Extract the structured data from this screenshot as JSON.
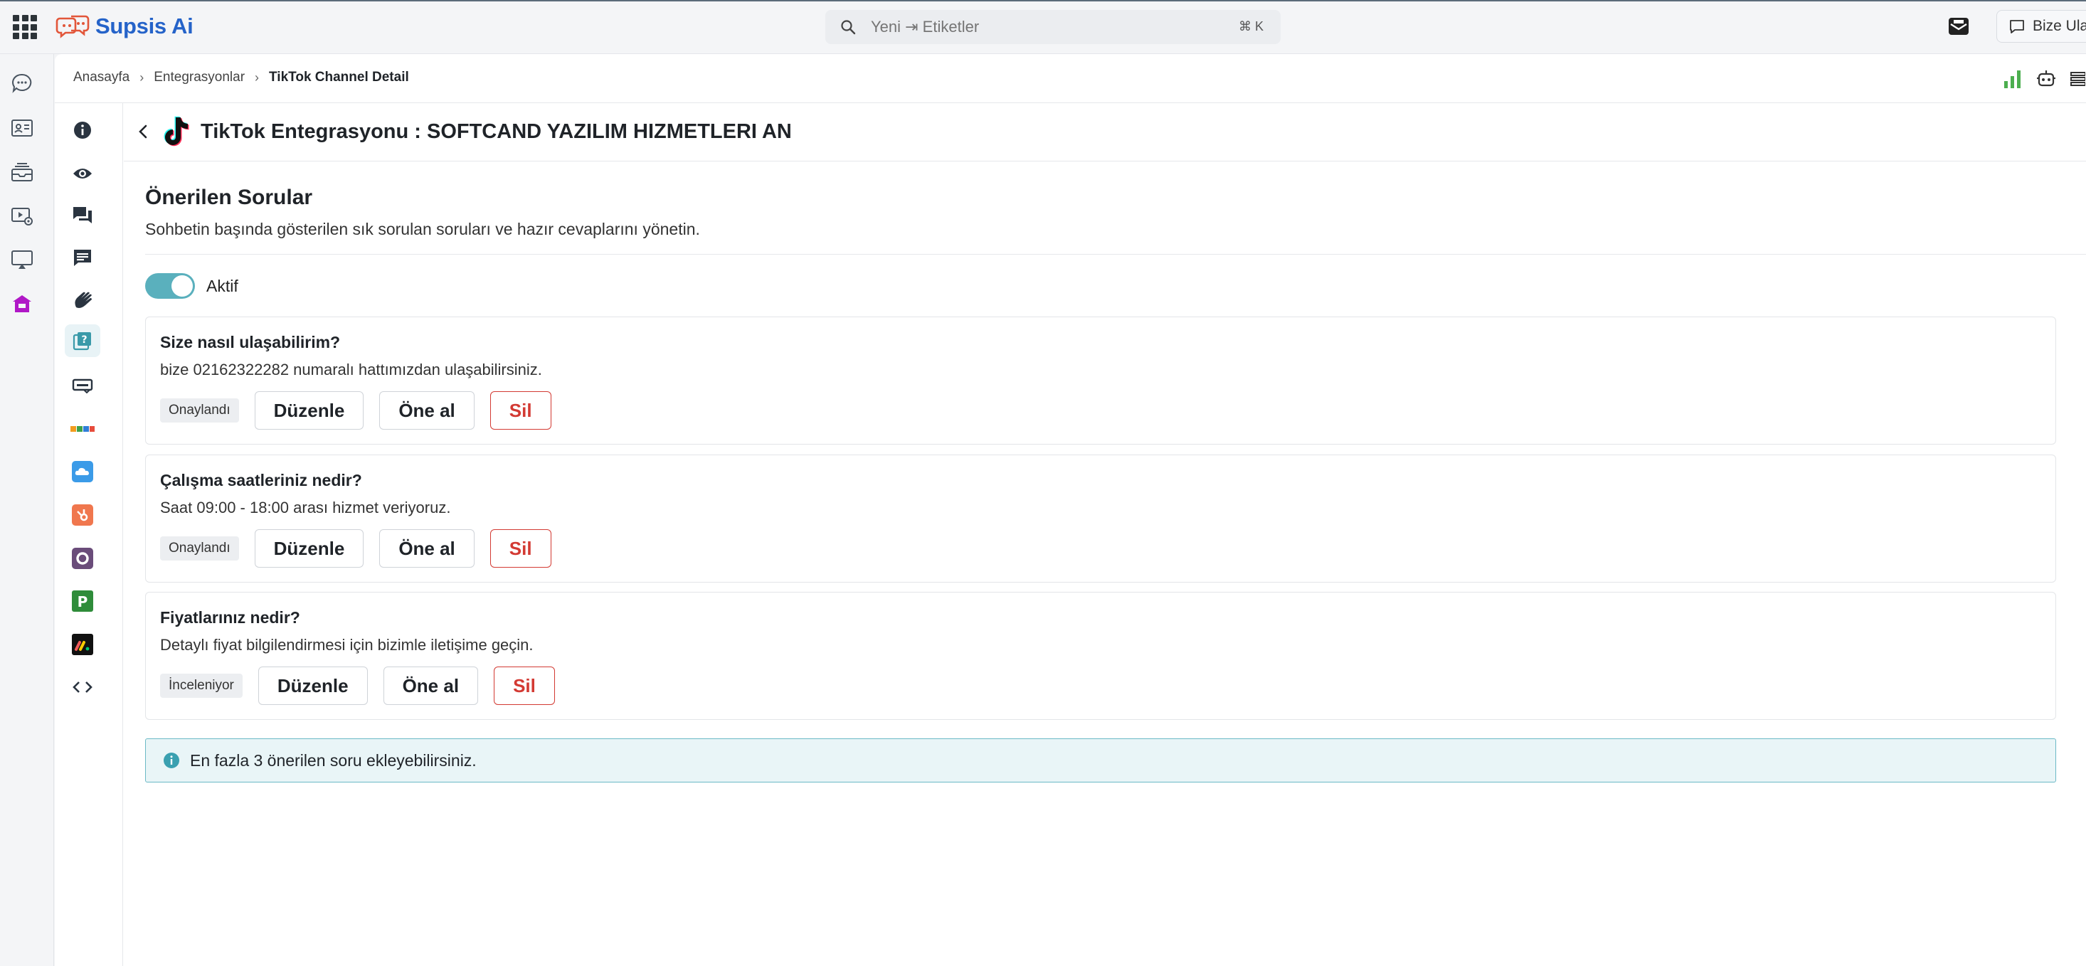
{
  "app": {
    "name": "Supsis Ai"
  },
  "search": {
    "placeholder": "Yeni ⇥ Etiketler",
    "shortcut": "⌘ K"
  },
  "top_right": {
    "contact_label": "Bize Ula"
  },
  "rail_icons": [
    "chat-bubble-icon",
    "contact-card-icon",
    "inbox-icon",
    "video-settings-icon",
    "screen-cast-icon",
    "store-icon"
  ],
  "breadcrumb": {
    "items": [
      "Anasayfa",
      "Entegrasyonlar"
    ],
    "current": "TikTok Channel Detail"
  },
  "subnav_icons": [
    "info-icon",
    "eye-icon",
    "forum-icon",
    "comment-icon",
    "waving-hand-icon",
    "quiz-icon",
    "keyboard-icon",
    "rainbow-app-icon",
    "cloud-icon",
    "hubspot-icon",
    "circle-app-icon",
    "p-app-icon",
    "monday-app-icon",
    "code-icon"
  ],
  "header": {
    "title": "TikTok Entegrasyonu : SOFTCAND YAZILIM HIZMETLERI AN"
  },
  "section": {
    "title": "Önerilen Sorular",
    "description": "Sohbetin başında gösterilen sık sorulan soruları ve hazır cevaplarını yönetin."
  },
  "toggle": {
    "label": "Aktif",
    "on": true
  },
  "actions": {
    "edit": "Düzenle",
    "promote": "Öne al",
    "delete": "Sil"
  },
  "questions": [
    {
      "question": "Size nasıl ulaşabilirim?",
      "answer": "bize 02162322282 numaralı hattımızdan ulaşabilirsiniz.",
      "status": "Onaylandı"
    },
    {
      "question": "Çalışma saatleriniz nedir?",
      "answer": "Saat 09:00 - 18:00 arası hizmet veriyoruz.",
      "status": "Onaylandı"
    },
    {
      "question": "Fiyatlarınız nedir?",
      "answer": "Detaylı fiyat bilgilendirmesi için bizimle iletişime geçin.",
      "status": "İnceleniyor"
    }
  ],
  "info": {
    "text": "En fazla 3 önerilen soru ekleyebilirsiniz."
  },
  "colors": {
    "brand": "#2563c9",
    "accent": "#5ab0bd",
    "danger": "#d33a33",
    "signal": "#4cae4f"
  }
}
